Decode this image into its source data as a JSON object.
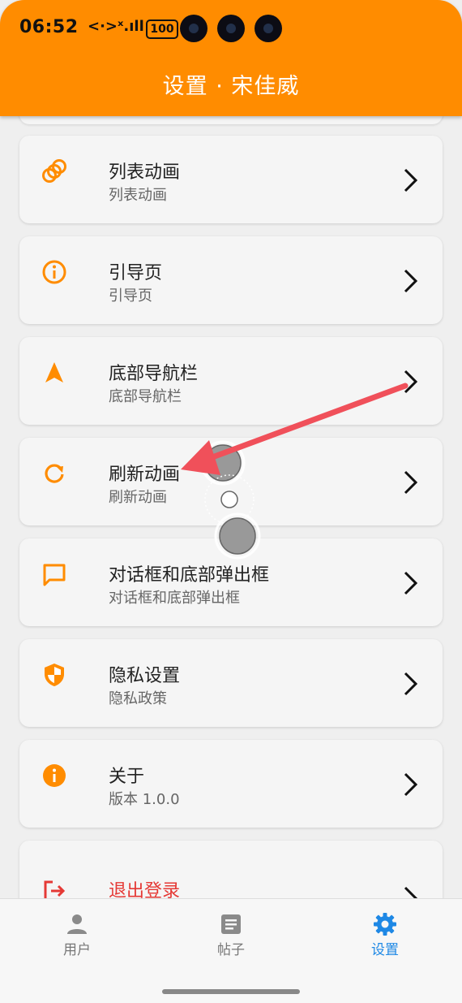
{
  "status": {
    "time": "06:52",
    "network": "<·>ˣ.ıll",
    "battery": "100"
  },
  "header": {
    "title": "设置 · 宋佳威"
  },
  "items": [
    {
      "title": "列表动画",
      "subtitle": "列表动画",
      "icon": "rings-icon"
    },
    {
      "title": "引导页",
      "subtitle": "引导页",
      "icon": "info-outline-icon"
    },
    {
      "title": "底部导航栏",
      "subtitle": "底部导航栏",
      "icon": "navigation-arrow-icon"
    },
    {
      "title": "刷新动画",
      "subtitle": "刷新动画",
      "icon": "refresh-icon"
    },
    {
      "title": "对话框和底部弹出框",
      "subtitle": "对话框和底部弹出框",
      "icon": "chat-bubble-icon"
    },
    {
      "title": "隐私设置",
      "subtitle": "隐私政策",
      "icon": "shield-icon"
    },
    {
      "title": "关于",
      "subtitle": "版本 1.0.0",
      "icon": "info-filled-icon"
    },
    {
      "title": "退出登录",
      "subtitle": "",
      "icon": "logout-icon"
    }
  ],
  "bottom_nav": [
    {
      "label": "用户",
      "icon": "person-icon",
      "active": false
    },
    {
      "label": "帖子",
      "icon": "article-icon",
      "active": false
    },
    {
      "label": "设置",
      "icon": "gear-icon",
      "active": true
    }
  ],
  "colors": {
    "accent": "#ff8c00",
    "active_tab": "#1e88e5",
    "logout": "#e53935",
    "annotation_arrow": "#f0505a"
  }
}
